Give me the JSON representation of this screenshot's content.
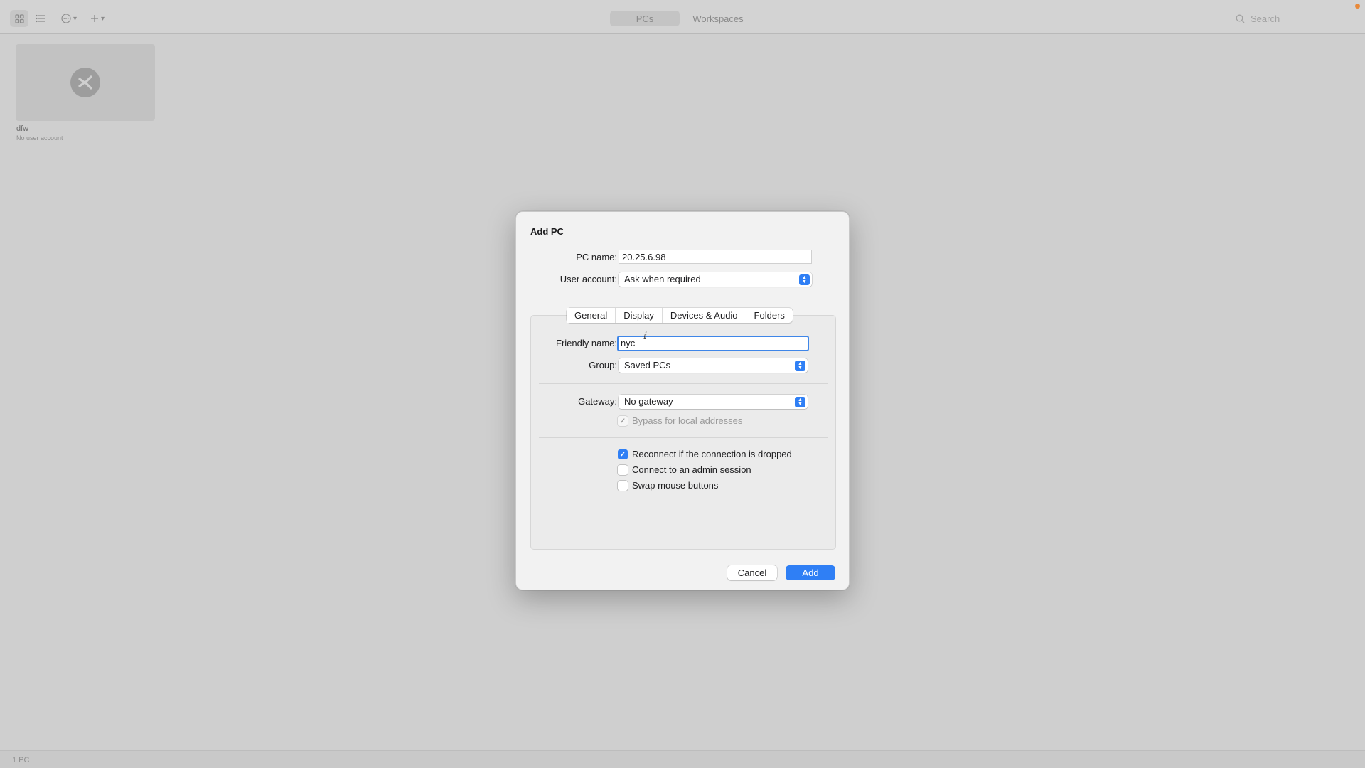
{
  "toolbar": {
    "view_grid_icon": "grid-icon",
    "view_list_icon": "list-icon",
    "more_icon": "ellipsis-circle-icon",
    "add_icon": "plus-icon",
    "segments": [
      "PCs",
      "Workspaces"
    ],
    "selected_segment": "PCs",
    "search_placeholder": "Search"
  },
  "pcs": [
    {
      "name": "dfw",
      "subtitle": "No user account"
    }
  ],
  "status_bar": {
    "count_text": "1 PC"
  },
  "dialog": {
    "title": "Add PC",
    "pc_name_label": "PC name:",
    "pc_name_value": "20.25.6.98",
    "user_account_label": "User account:",
    "user_account_value": "Ask when required",
    "tabs": [
      "General",
      "Display",
      "Devices & Audio",
      "Folders"
    ],
    "selected_tab": "General",
    "friendly_name_label": "Friendly name:",
    "friendly_name_value": "nyc",
    "group_label": "Group:",
    "group_value": "Saved PCs",
    "gateway_label": "Gateway:",
    "gateway_value": "No gateway",
    "bypass_label": "Bypass for local addresses",
    "bypass_checked": true,
    "bypass_enabled": false,
    "options": [
      {
        "label": "Reconnect if the connection is dropped",
        "checked": true
      },
      {
        "label": "Connect to an admin session",
        "checked": false
      },
      {
        "label": "Swap mouse buttons",
        "checked": false
      }
    ],
    "cancel_label": "Cancel",
    "add_label": "Add"
  },
  "colors": {
    "accent": "#2f7ff5",
    "focus_ring": "#3f86e8",
    "background": "#cfcfcf"
  }
}
